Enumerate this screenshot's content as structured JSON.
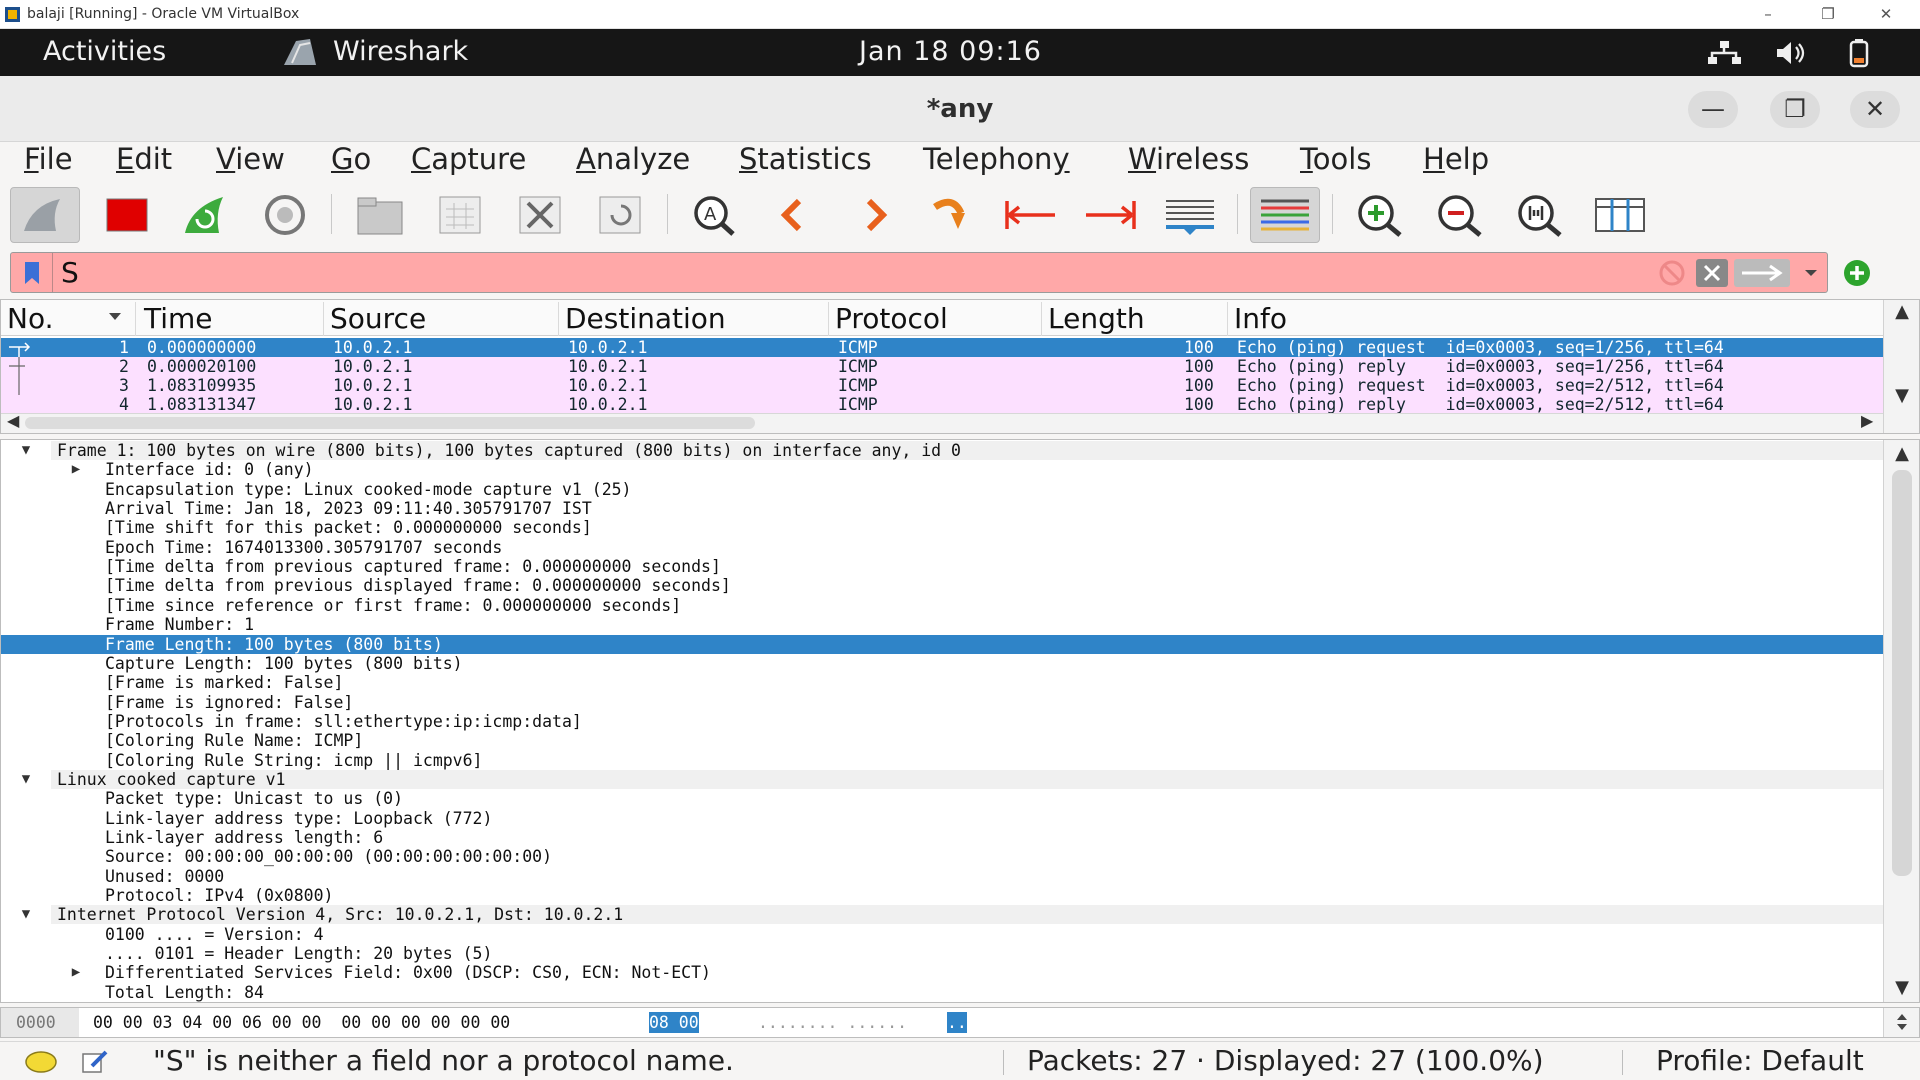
{
  "host": {
    "title": "balaji [Running] - Oracle VM VirtualBox",
    "controls": [
      "–",
      "❐",
      "✕"
    ]
  },
  "gnome": {
    "activities": "Activities",
    "app_name": "Wireshark",
    "clock": "Jan 18  09:16"
  },
  "window": {
    "title": "*any",
    "controls": [
      "—",
      "❐",
      "✕"
    ]
  },
  "menu": [
    {
      "key": "F",
      "rest": "ile"
    },
    {
      "key": "E",
      "rest": "dit"
    },
    {
      "key": "V",
      "rest": "iew"
    },
    {
      "key": "G",
      "rest": "o"
    },
    {
      "key": "C",
      "rest": "apture"
    },
    {
      "key": "A",
      "rest": "nalyze"
    },
    {
      "key": "S",
      "rest": "tatistics"
    },
    {
      "key": "",
      "rest": "Telephon",
      "key2": "y"
    },
    {
      "key": "W",
      "rest": "ireless"
    },
    {
      "key": "T",
      "rest": "ools"
    },
    {
      "key": "H",
      "rest": "elp"
    }
  ],
  "toolbar": {
    "icons": [
      "shark-fin-icon",
      "stop-capture-icon",
      "restart-capture-icon",
      "capture-options-icon",
      "open-file-icon",
      "save-file-icon",
      "close-file-icon",
      "reload-file-icon",
      "find-packet-icon",
      "go-back-icon",
      "go-forward-icon",
      "go-to-packet-icon",
      "first-packet-icon",
      "last-packet-icon",
      "auto-scroll-icon",
      "colorize-icon",
      "zoom-in-icon",
      "zoom-out-icon",
      "normal-size-icon",
      "resize-columns-icon"
    ]
  },
  "filter": {
    "value": "S"
  },
  "packet_list": {
    "columns": [
      "No.",
      "Time",
      "Source",
      "Destination",
      "Protocol",
      "Length",
      "Info"
    ],
    "rows": [
      {
        "no": "1",
        "time": "0.000000000",
        "src": "10.0.2.1",
        "dst": "10.0.2.1",
        "proto": "ICMP",
        "len": "100",
        "info": "Echo (ping) request  id=0x0003, seq=1/256, ttl=64"
      },
      {
        "no": "2",
        "time": "0.000020100",
        "src": "10.0.2.1",
        "dst": "10.0.2.1",
        "proto": "ICMP",
        "len": "100",
        "info": "Echo (ping) reply    id=0x0003, seq=1/256, ttl=64"
      },
      {
        "no": "3",
        "time": "1.083109935",
        "src": "10.0.2.1",
        "dst": "10.0.2.1",
        "proto": "ICMP",
        "len": "100",
        "info": "Echo (ping) request  id=0x0003, seq=2/512, ttl=64"
      },
      {
        "no": "4",
        "time": "1.083131347",
        "src": "10.0.2.1",
        "dst": "10.0.2.1",
        "proto": "ICMP",
        "len": "100",
        "info": "Echo (ping) reply    id=0x0003, seq=2/512, ttl=64"
      }
    ],
    "selected_row": 0
  },
  "details": [
    {
      "indent": 0,
      "tw": "open",
      "text": "Frame 1: 100 bytes on wire (800 bits), 100 bytes captured (800 bits) on interface any, id 0"
    },
    {
      "indent": 1,
      "tw": "closed",
      "text": "Interface id: 0 (any)"
    },
    {
      "indent": 1,
      "tw": "",
      "text": "Encapsulation type: Linux cooked-mode capture v1 (25)"
    },
    {
      "indent": 1,
      "tw": "",
      "text": "Arrival Time: Jan 18, 2023 09:11:40.305791707 IST"
    },
    {
      "indent": 1,
      "tw": "",
      "text": "[Time shift for this packet: 0.000000000 seconds]"
    },
    {
      "indent": 1,
      "tw": "",
      "text": "Epoch Time: 1674013300.305791707 seconds"
    },
    {
      "indent": 1,
      "tw": "",
      "text": "[Time delta from previous captured frame: 0.000000000 seconds]"
    },
    {
      "indent": 1,
      "tw": "",
      "text": "[Time delta from previous displayed frame: 0.000000000 seconds]"
    },
    {
      "indent": 1,
      "tw": "",
      "text": "[Time since reference or first frame: 0.000000000 seconds]"
    },
    {
      "indent": 1,
      "tw": "",
      "text": "Frame Number: 1"
    },
    {
      "indent": 1,
      "tw": "",
      "text": "Frame Length: 100 bytes (800 bits)",
      "selected": true
    },
    {
      "indent": 1,
      "tw": "",
      "text": "Capture Length: 100 bytes (800 bits)"
    },
    {
      "indent": 1,
      "tw": "",
      "text": "[Frame is marked: False]"
    },
    {
      "indent": 1,
      "tw": "",
      "text": "[Frame is ignored: False]"
    },
    {
      "indent": 1,
      "tw": "",
      "text": "[Protocols in frame: sll:ethertype:ip:icmp:data]"
    },
    {
      "indent": 1,
      "tw": "",
      "text": "[Coloring Rule Name: ICMP]"
    },
    {
      "indent": 1,
      "tw": "",
      "text": "[Coloring Rule String: icmp || icmpv6]"
    },
    {
      "indent": 0,
      "tw": "open",
      "text": "Linux cooked capture v1"
    },
    {
      "indent": 1,
      "tw": "",
      "text": "Packet type: Unicast to us (0)"
    },
    {
      "indent": 1,
      "tw": "",
      "text": "Link-layer address type: Loopback (772)"
    },
    {
      "indent": 1,
      "tw": "",
      "text": "Link-layer address length: 6"
    },
    {
      "indent": 1,
      "tw": "",
      "text": "Source: 00:00:00_00:00:00 (00:00:00:00:00:00)"
    },
    {
      "indent": 1,
      "tw": "",
      "text": "Unused: 0000"
    },
    {
      "indent": 1,
      "tw": "",
      "text": "Protocol: IPv4 (0x0800)"
    },
    {
      "indent": 0,
      "tw": "open",
      "text": "Internet Protocol Version 4, Src: 10.0.2.1, Dst: 10.0.2.1"
    },
    {
      "indent": 1,
      "tw": "",
      "text": "0100 .... = Version: 4"
    },
    {
      "indent": 1,
      "tw": "",
      "text": ".... 0101 = Header Length: 20 bytes (5)"
    },
    {
      "indent": 1,
      "tw": "closed",
      "text": "Differentiated Services Field: 0x00 (DSCP: CS0, ECN: Not-ECT)"
    },
    {
      "indent": 1,
      "tw": "",
      "text": "Total Length: 84"
    }
  ],
  "bytes": {
    "offset": "0000",
    "hex": "00 00 03 04 00 06 00 00  00 00 00 00 00 00",
    "hex_hi": "08 00",
    "ascii": "........ ......",
    "ascii_hi": ".."
  },
  "status": {
    "message": "\"S\" is neither a field nor a protocol name.",
    "packets": "Packets: 27 · Displayed: 27 (100.0%)",
    "profile": "Profile: Default"
  },
  "colors": {
    "selected": "#2f84c8",
    "icmp_row": "#fce0ff",
    "filter_error": "#ffa8a8"
  }
}
